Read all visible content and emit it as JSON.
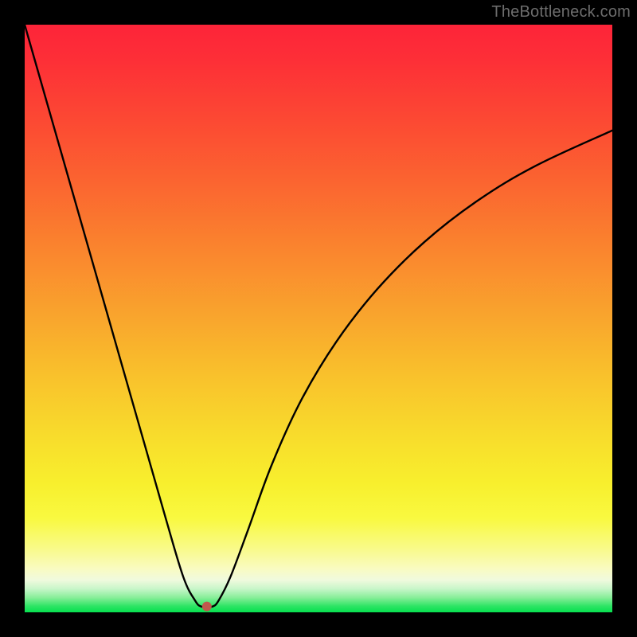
{
  "watermark": "TheBottleneck.com",
  "chart_data": {
    "type": "line",
    "title": "",
    "xlabel": "",
    "ylabel": "",
    "xlim": [
      0,
      100
    ],
    "ylim": [
      0,
      100
    ],
    "series": [
      {
        "name": "curve",
        "x": [
          0,
          4,
          8,
          12,
          16,
          20,
          24,
          27,
          29,
          30,
          31,
          32,
          33,
          35,
          38,
          42,
          47,
          53,
          60,
          68,
          77,
          87,
          100
        ],
        "y": [
          100,
          86,
          72,
          58,
          44,
          30,
          16,
          6,
          2,
          1,
          1,
          1,
          2,
          6,
          14,
          25,
          36,
          46,
          55,
          63,
          70,
          76,
          82
        ]
      }
    ],
    "marker": {
      "x": 31,
      "y": 1,
      "color": "#c0584d",
      "radius_px": 6
    },
    "background_gradient": {
      "top": "#fd2439",
      "mid": "#f8dc2c",
      "bottom": "#07e04f"
    }
  }
}
